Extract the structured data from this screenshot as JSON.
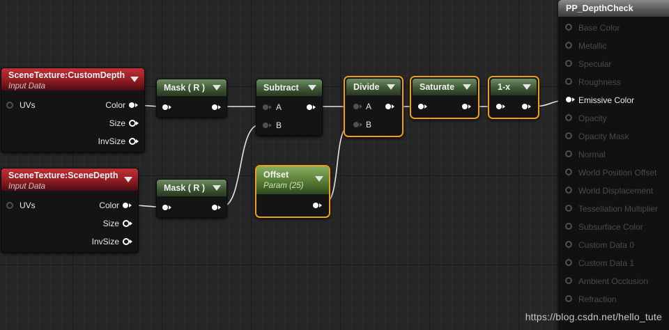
{
  "watermark": "https://blog.csdn.net/hello_tute",
  "colors": {
    "wire": "#e6e6e6",
    "selection": "#f0a018",
    "texture_header": "#8a1a20",
    "math_header": "#3f5a37",
    "param_header": "#557a36"
  },
  "nodes": {
    "custom_depth": {
      "title": "SceneTexture:CustomDepth",
      "subtitle": "Input Data",
      "uvs": "UVs",
      "color": "Color",
      "size": "Size",
      "invsize": "InvSize"
    },
    "scene_depth": {
      "title": "SceneTexture:SceneDepth",
      "subtitle": "Input Data",
      "uvs": "UVs",
      "color": "Color",
      "size": "Size",
      "invsize": "InvSize"
    },
    "mask1": {
      "title": "Mask ( R )"
    },
    "mask2": {
      "title": "Mask ( R )"
    },
    "subtract": {
      "title": "Subtract",
      "a": "A",
      "b": "B"
    },
    "divide": {
      "title": "Divide",
      "a": "A",
      "b": "B"
    },
    "saturate": {
      "title": "Saturate"
    },
    "oneminus": {
      "title": "1-x"
    },
    "offset": {
      "title": "Offset",
      "subtitle": "Param (25)"
    }
  },
  "result": {
    "title": "PP_DepthCheck",
    "inputs": [
      {
        "label": "Base Color",
        "active": false
      },
      {
        "label": "Metallic",
        "active": false
      },
      {
        "label": "Specular",
        "active": false
      },
      {
        "label": "Roughness",
        "active": false
      },
      {
        "label": "Emissive Color",
        "active": true
      },
      {
        "label": "Opacity",
        "active": false
      },
      {
        "label": "Opacity Mask",
        "active": false
      },
      {
        "label": "Normal",
        "active": false
      },
      {
        "label": "World Position Offset",
        "active": false
      },
      {
        "label": "World Displacement",
        "active": false
      },
      {
        "label": "Tessellation Multiplier",
        "active": false
      },
      {
        "label": "Subsurface Color",
        "active": false
      },
      {
        "label": "Custom Data 0",
        "active": false
      },
      {
        "label": "Custom Data 1",
        "active": false
      },
      {
        "label": "Ambient Occlusion",
        "active": false
      },
      {
        "label": "Refraction",
        "active": false
      }
    ]
  }
}
